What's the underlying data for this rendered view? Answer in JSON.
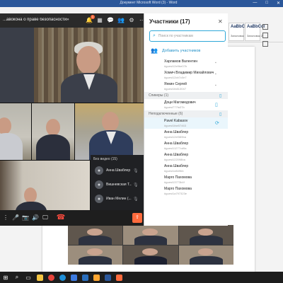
{
  "word": {
    "title": "Документ Microsoft Word (3) - Word",
    "styles": [
      {
        "sample": "AaBbCc",
        "name": "Заголовок 1"
      },
      {
        "sample": "AaBbCcI",
        "name": "Заголовок 2"
      }
    ],
    "window_controls": [
      "—",
      "□",
      "✕"
    ]
  },
  "meeting": {
    "title": "Круглый стол на тему «Криминология закона о праве безопасности»",
    "title_shown": "...авокона о праве безопасности»",
    "chat_badge": "1",
    "no_video": {
      "title": "Без видео (15)",
      "items": [
        {
          "name": "Анна Шваблер"
        },
        {
          "name": "Вишневская Т..."
        },
        {
          "name": "Иван Мелин (..."
        }
      ]
    }
  },
  "participants": {
    "header": "Участники (17)",
    "search_placeholder": "Поиск по участникам",
    "add_label": "Добавить участников",
    "top": [
      {
        "name": "Харламов Валентин",
        "id": "#guest12e9be07b"
      },
      {
        "name": "Хомич Владимир Михайлович",
        "id": "#guest12cb7c0e7"
      },
      {
        "name": "Янкин Сергей",
        "id": "#guest1fa513047"
      }
    ],
    "speakers_title": "Спикеры (1)",
    "speakers": [
      {
        "name": "Доци Магомедович",
        "id": "#guest777fa37b"
      }
    ],
    "unconnected_title": "Неподключенные (6)",
    "unconnected": [
      {
        "name": "Pavel Kabasov",
        "id": "#guest1fae57463"
      },
      {
        "name": "Анна Шваблер",
        "id": "#guest12ef389ba"
      },
      {
        "name": "Анна Шваблер",
        "id": "#guest11277cd9a"
      },
      {
        "name": "Анна Шваблер",
        "id": "#guest122098ba"
      },
      {
        "name": "Анна Шваблер",
        "id": "#guest1d849bb"
      },
      {
        "name": "Марго Пахомова",
        "id": "#guest13773b4f"
      },
      {
        "name": "Марго Пахомова",
        "id": "#guest1a797323e"
      }
    ]
  }
}
